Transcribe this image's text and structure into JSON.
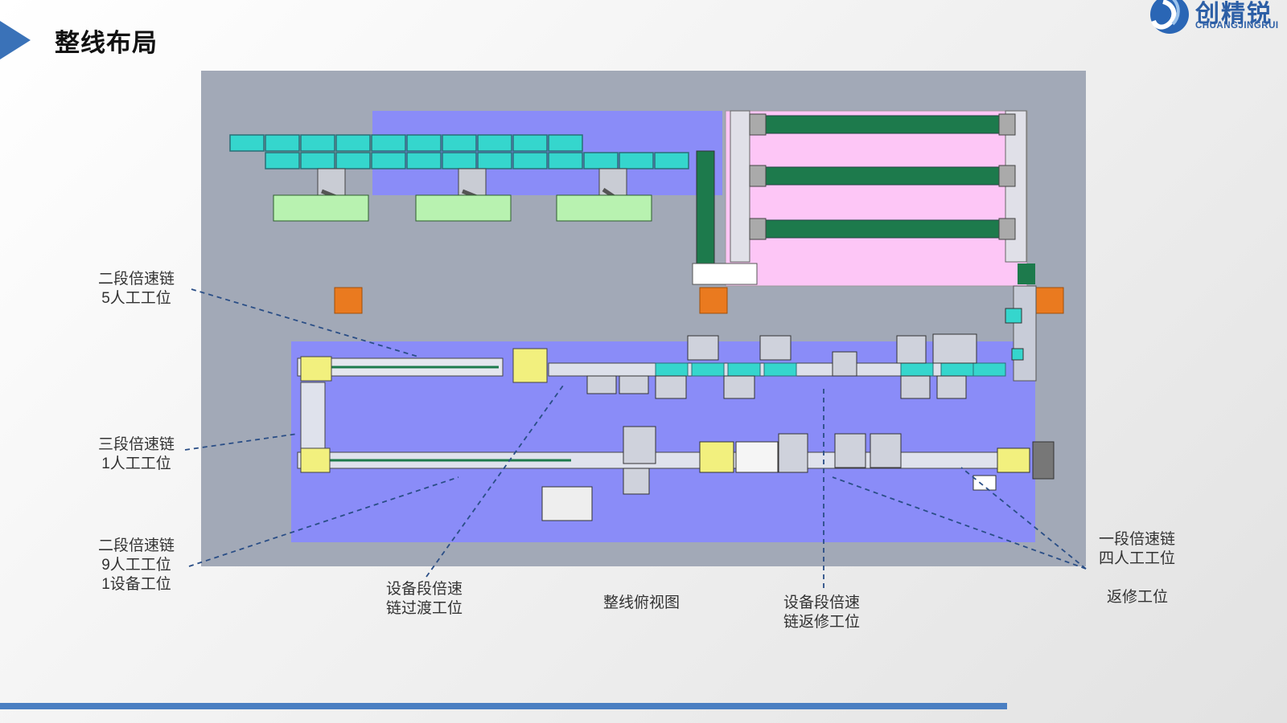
{
  "slide": {
    "title": "整线布局"
  },
  "logo": {
    "name_cn": "创精锐",
    "name_en": "CHUANGJINGRUI"
  },
  "labels": {
    "stage2_chain_5": {
      "line1": "二段倍速链",
      "line2": "5人工工位"
    },
    "stage3_chain_1": {
      "line1": "三段倍速链",
      "line2": "1人工工位"
    },
    "stage2_chain_9": {
      "line1": "二段倍速链",
      "line2": "9人工工位",
      "line3": "1设备工位"
    },
    "equip_transition": {
      "line1": "设备段倍速",
      "line2": "链过渡工位"
    },
    "overview": {
      "line1": "整线俯视图"
    },
    "equip_return": {
      "line1": "设备段倍速",
      "line2": "链返修工位"
    },
    "stage1_chain_4": {
      "line1": "一段倍速链",
      "line2": "四人工工位"
    },
    "repair": {
      "line1": "返修工位"
    }
  },
  "colors": {
    "accent": "#3a72b8",
    "plan_bg": "#a2a9b7",
    "zone_blue": "#8a8cf8",
    "zone_pink": "#fdc6f6",
    "conveyor_green": "#1d7a4c",
    "station_cyan": "#35d6cd",
    "station_lightgreen": "#b8f2b0",
    "pallet_yellow": "#f2f07e",
    "marker_orange": "#ea7a1f",
    "leader_line": "#2a4e86"
  }
}
